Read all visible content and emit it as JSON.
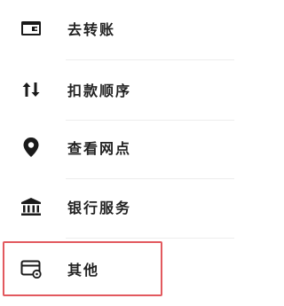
{
  "menu": {
    "items": [
      {
        "label": "去转账",
        "icon": "transfer-card-icon"
      },
      {
        "label": "扣款顺序",
        "icon": "sort-arrows-icon"
      },
      {
        "label": "查看网点",
        "icon": "location-pin-icon"
      },
      {
        "label": "银行服务",
        "icon": "bank-building-icon"
      },
      {
        "label": "其他",
        "icon": "card-settings-icon"
      }
    ]
  },
  "colors": {
    "text": "#222222",
    "icon": "#1a1a1a",
    "divider": "#ededed",
    "highlight": "#e2595e"
  }
}
